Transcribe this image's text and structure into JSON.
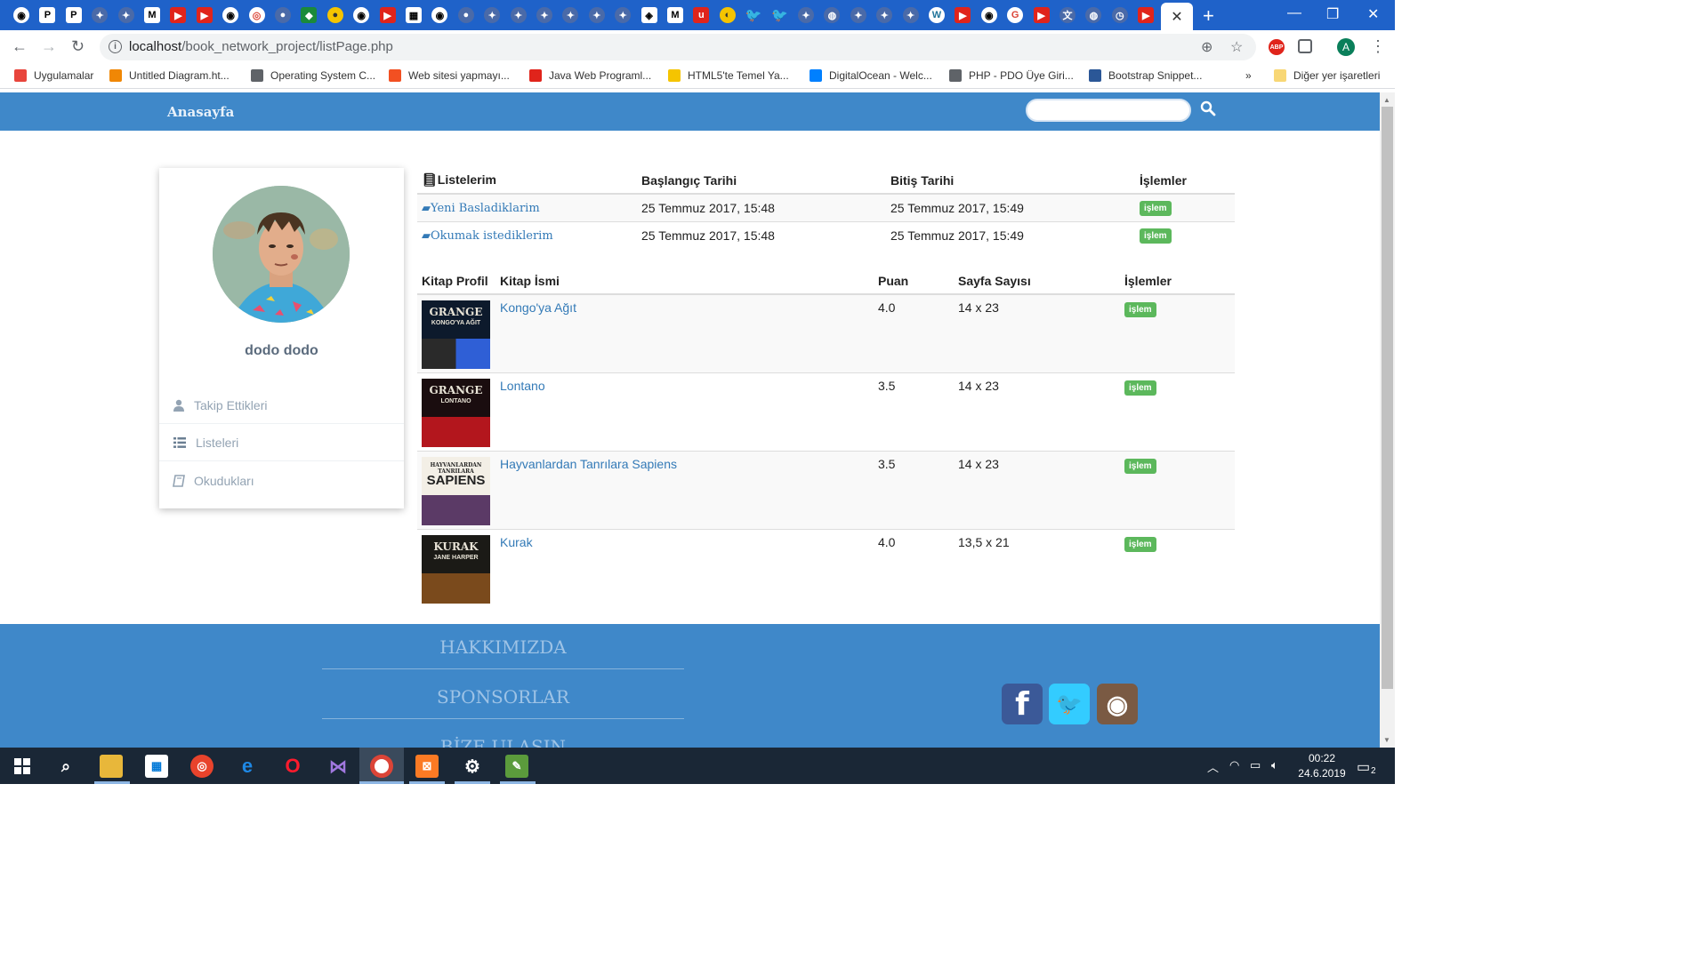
{
  "browser": {
    "url_host": "localhost",
    "url_path": "/book_network_project/listPage.php",
    "active_tab_close": "✕",
    "new_tab": "+",
    "profile_initial": "A",
    "abp_label": "ABP",
    "bookmarks": [
      {
        "label": "Uygulamalar",
        "color": "#e8453c"
      },
      {
        "label": "Untitled Diagram.ht...",
        "color": "#f08705"
      },
      {
        "label": "Operating System C...",
        "color": "#5f6368"
      },
      {
        "label": "Web sitesi yapmayı...",
        "color": "#f25022"
      },
      {
        "label": "Java Web Programl...",
        "color": "#e0241b"
      },
      {
        "label": "HTML5'te Temel Ya...",
        "color": "#f5c400"
      },
      {
        "label": "DigitalOcean - Welc...",
        "color": "#0080ff"
      },
      {
        "label": "PHP - PDO Üye Giri...",
        "color": "#5f6368"
      },
      {
        "label": "Bootstrap Snippet...",
        "color": "#2b5797"
      }
    ],
    "bookmarks_more": "»",
    "other_bookmarks": "Diğer yer işaretleri",
    "tab_icons": [
      {
        "cls": "gh",
        "txt": "◉"
      },
      {
        "cls": "med",
        "txt": "P"
      },
      {
        "cls": "med",
        "txt": "P"
      },
      {
        "cls": "bluegrey",
        "txt": "✦"
      },
      {
        "cls": "bluegrey",
        "txt": "✦"
      },
      {
        "cls": "med",
        "txt": "M"
      },
      {
        "cls": "yt",
        "txt": "▶"
      },
      {
        "cls": "yt",
        "txt": "▶"
      },
      {
        "cls": "gh",
        "txt": "◉"
      },
      {
        "cls": "g",
        "txt": "◎"
      },
      {
        "cls": "bluegrey",
        "txt": "●"
      },
      {
        "cls": "grn",
        "txt": "◆"
      },
      {
        "cls": "yel",
        "txt": "●"
      },
      {
        "cls": "gh",
        "txt": "◉"
      },
      {
        "cls": "yt",
        "txt": "▶"
      },
      {
        "cls": "med",
        "txt": "▦"
      },
      {
        "cls": "gh",
        "txt": "◉"
      },
      {
        "cls": "bluegrey",
        "txt": "●"
      },
      {
        "cls": "bluegrey",
        "txt": "✦"
      },
      {
        "cls": "bluegrey",
        "txt": "✦"
      },
      {
        "cls": "bluegrey",
        "txt": "✦"
      },
      {
        "cls": "bluegrey",
        "txt": "✦"
      },
      {
        "cls": "bluegrey",
        "txt": "✦"
      },
      {
        "cls": "bluegrey",
        "txt": "✦"
      },
      {
        "cls": "med",
        "txt": "◈"
      },
      {
        "cls": "med",
        "txt": "M"
      },
      {
        "cls": "yt",
        "txt": "u"
      },
      {
        "cls": "yel",
        "txt": "◐"
      },
      {
        "cls": "tw",
        "txt": "🐦"
      },
      {
        "cls": "tw",
        "txt": "🐦"
      },
      {
        "cls": "bluegrey",
        "txt": "✦"
      },
      {
        "cls": "bluegrey",
        "txt": "◍"
      },
      {
        "cls": "bluegrey",
        "txt": "✦"
      },
      {
        "cls": "bluegrey",
        "txt": "✦"
      },
      {
        "cls": "bluegrey",
        "txt": "✦"
      },
      {
        "cls": "wp",
        "txt": "W"
      },
      {
        "cls": "yt",
        "txt": "▶"
      },
      {
        "cls": "gh",
        "txt": "◉"
      },
      {
        "cls": "g",
        "txt": "G"
      },
      {
        "cls": "yt",
        "txt": "▶"
      },
      {
        "cls": "bluegrey",
        "txt": "文"
      },
      {
        "cls": "bluegrey",
        "txt": "◍"
      },
      {
        "cls": "bluegrey",
        "txt": "◷"
      },
      {
        "cls": "yt",
        "txt": "▶"
      }
    ]
  },
  "site": {
    "brand": "Anasayfa",
    "search_value": "",
    "accent": "#3f88c9"
  },
  "profile": {
    "name": "dodo dodo",
    "menu": [
      {
        "label": "Takip Ettikleri",
        "icon": "user-icon"
      },
      {
        "label": "Listeleri",
        "icon": "list-icon"
      },
      {
        "label": "Okudukları",
        "icon": "book-icon"
      }
    ]
  },
  "lists_table": {
    "headers": [
      "Listelerim",
      "Başlangıç Tarihi",
      "Bitiş Tarihi",
      "İşlemler"
    ],
    "rows": [
      {
        "name": "Yeni Basladiklarim",
        "start": "25 Temmuz 2017, 15:48",
        "end": "25 Temmuz 2017, 15:49",
        "action": "işlem"
      },
      {
        "name": "Okumak istediklerim",
        "start": "25 Temmuz 2017, 15:48",
        "end": "25 Temmuz 2017, 15:49",
        "action": "işlem"
      }
    ]
  },
  "books_table": {
    "headers": [
      "Kitap Profil",
      "Kitap İsmi",
      "Puan",
      "Sayfa Sayısı",
      "İşlemler"
    ],
    "rows": [
      {
        "title": "Kongo'ya Ağıt",
        "score": "4.0",
        "size": "14 x 23",
        "action": "işlem",
        "cover_top": "GRANGE",
        "cover_sub": "KONGO'YA AĞIT",
        "cover_bg": "#0d1a2c"
      },
      {
        "title": "Lontano",
        "score": "3.5",
        "size": "14 x 23",
        "action": "işlem",
        "cover_top": "GRANGE",
        "cover_sub": "LONTANO",
        "cover_bg": "#1a0d0f"
      },
      {
        "title": "Hayvanlardan Tanrılara Sapiens",
        "score": "3.5",
        "size": "14 x 23",
        "action": "işlem",
        "cover_top": "HAYVANLARDAN TANRILARA",
        "cover_sub": "SAPIENS",
        "cover_bg": "#f3efe6"
      },
      {
        "title": "Kurak",
        "score": "4.0",
        "size": "13,5 x 21",
        "action": "işlem",
        "cover_top": "KURAK",
        "cover_sub": "JANE HARPER",
        "cover_bg": "#1b1a16"
      }
    ]
  },
  "footer": {
    "links": [
      "HAKKIMIZDA",
      "SPONSORLAR",
      "BİZE ULAŞIN"
    ],
    "social": [
      {
        "name": "facebook",
        "glyph": "f",
        "color": "#3b5998"
      },
      {
        "name": "twitter",
        "glyph": "🐦",
        "color": "#33ccff"
      },
      {
        "name": "instagram",
        "glyph": "◉",
        "color": "#7a5a43"
      }
    ]
  },
  "taskbar": {
    "time": "00:22",
    "date": "24.6.2019",
    "notifications": "2"
  }
}
